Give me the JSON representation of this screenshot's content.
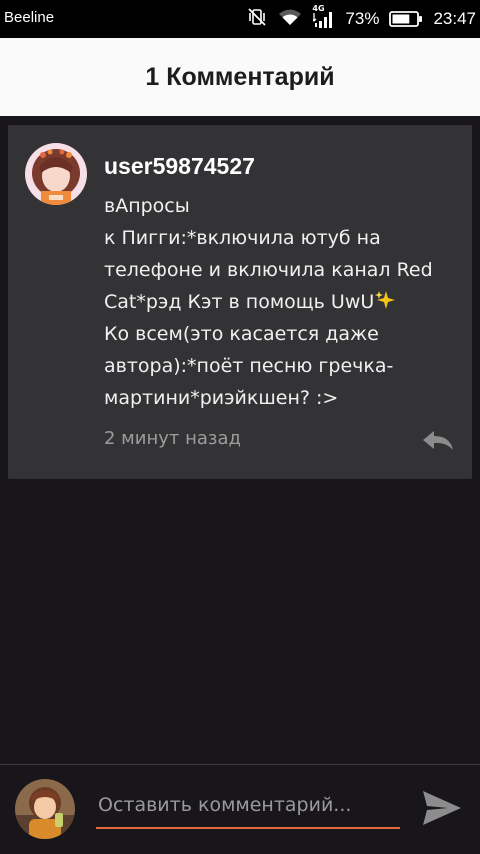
{
  "status_bar": {
    "carrier": "Beeline",
    "network": "4G",
    "battery_percent": "73%",
    "battery_level": 0.73,
    "time": "23:47",
    "icons": [
      "vibrate-off-icon",
      "wifi-icon",
      "signal-icon",
      "battery-icon"
    ]
  },
  "header": {
    "title": "1 Комментарий"
  },
  "comment": {
    "username": "user59874527",
    "text_lines": [
      "вАпросы",
      "к Пигги:*включила ютуб на",
      "телефоне и включила канал Red",
      "Cat*рэд Кэт в помощь UwU",
      "Ко всем(это касается даже",
      "автора):*поёт песню гречка-",
      "мартини*риэйкшен? :>"
    ],
    "emoji": "sparkles-icon",
    "time": "2 минут назад",
    "reply_icon": "reply-icon"
  },
  "composer": {
    "placeholder": "Оставить комментарий...",
    "send_icon": "send-icon"
  },
  "colors": {
    "accent": "#e2693b",
    "card_bg": "#333335",
    "page_bg": "#18161a",
    "header_bg": "#fafafa"
  }
}
